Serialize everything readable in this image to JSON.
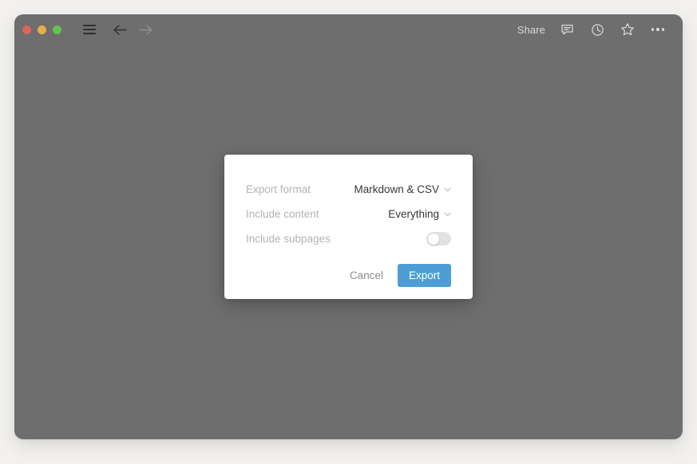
{
  "window": {
    "titlebar": {
      "traffic_lights": [
        {
          "name": "close",
          "color": "#df645e"
        },
        {
          "name": "minimize",
          "color": "#e7ae4a"
        },
        {
          "name": "maximize",
          "color": "#62c353"
        }
      ],
      "menu_icon": "hamburger-menu-icon",
      "back_icon": "arrow-left-icon",
      "forward_icon": "arrow-right-icon",
      "share_label": "Share",
      "comment_icon": "comment-icon",
      "history_icon": "clock-icon",
      "favorite_icon": "star-icon",
      "more_icon": "ellipsis-icon"
    }
  },
  "dialog": {
    "rows": [
      {
        "label": "Export format",
        "value": "Markdown & CSV",
        "control": "dropdown",
        "icon": "chevron-down-icon"
      },
      {
        "label": "Include content",
        "value": "Everything",
        "control": "dropdown",
        "icon": "chevron-down-icon"
      },
      {
        "label": "Include subpages",
        "value": "off",
        "control": "toggle"
      }
    ],
    "cancel_label": "Cancel",
    "export_label": "Export"
  },
  "colors": {
    "accent": "#4b9fd5",
    "scrim": "#6e6e6e",
    "page_background": "#f2f1ef",
    "dialog_background": "#ffffff",
    "label_text": "#b3b3b3",
    "value_text": "#363636",
    "cancel_text": "#8b8b8b"
  }
}
